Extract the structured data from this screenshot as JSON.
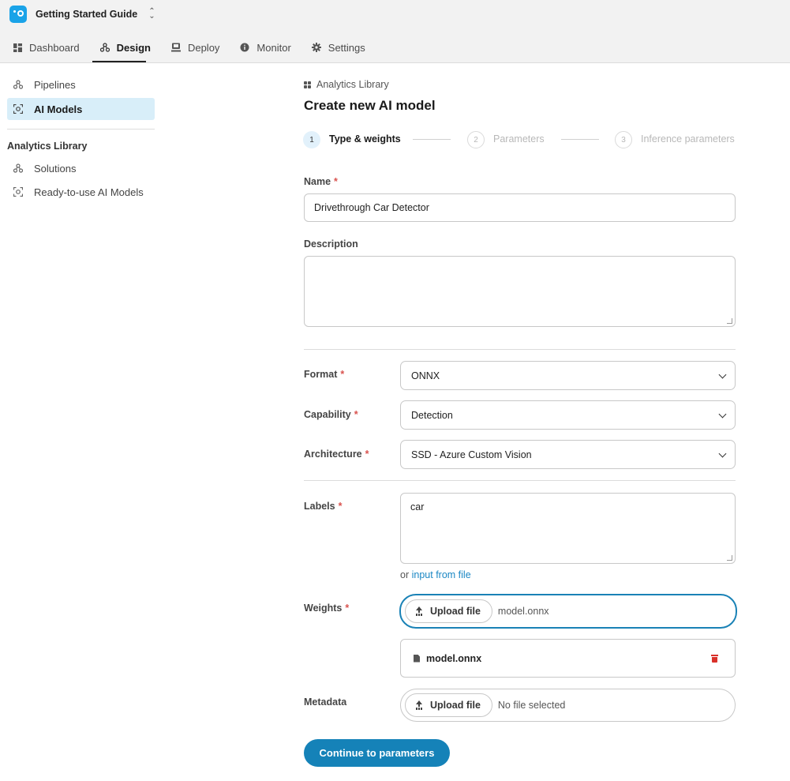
{
  "header": {
    "project_name": "Getting Started Guide",
    "switcher_icon": "chevron-up-down-icon",
    "tabs": [
      {
        "label": "Dashboard",
        "icon": "dashboard-icon"
      },
      {
        "label": "Design",
        "icon": "design-icon",
        "active": true
      },
      {
        "label": "Deploy",
        "icon": "deploy-icon"
      },
      {
        "label": "Monitor",
        "icon": "info-icon"
      },
      {
        "label": "Settings",
        "icon": "gear-icon"
      }
    ]
  },
  "sidebar": {
    "items": [
      {
        "label": "Pipelines",
        "icon": "pipelines-icon"
      },
      {
        "label": "AI Models",
        "icon": "ai-model-icon",
        "active": true
      }
    ],
    "section_title": "Analytics Library",
    "section_items": [
      {
        "label": "Solutions",
        "icon": "pipelines-icon"
      },
      {
        "label": "Ready-to-use AI Models",
        "icon": "ai-model-icon"
      }
    ]
  },
  "main": {
    "breadcrumb": "Analytics Library",
    "title": "Create new AI model",
    "steps": [
      {
        "number": "1",
        "label": "Type & weights",
        "active": true
      },
      {
        "number": "2",
        "label": "Parameters"
      },
      {
        "number": "3",
        "label": "Inference parameters"
      }
    ],
    "form": {
      "name_label": "Name",
      "name_value": "Drivethrough Car Detector",
      "description_label": "Description",
      "description_value": "",
      "format_label": "Format",
      "format_value": "ONNX",
      "capability_label": "Capability",
      "capability_value": "Detection",
      "architecture_label": "Architecture",
      "architecture_value": "SSD - Azure Custom Vision",
      "labels_label": "Labels",
      "labels_value": "car",
      "labels_or": "or",
      "labels_link": "input from file",
      "weights_label": "Weights",
      "weights_button": "Upload file",
      "weights_file": "model.onnx",
      "weights_uploaded_name": "model.onnx",
      "metadata_label": "Metadata",
      "metadata_button": "Upload file",
      "metadata_file": "No file selected",
      "required_marker": "*"
    },
    "continue_button": "Continue to parameters"
  },
  "colors": {
    "accent": "#1582b8",
    "active_bg": "#d8eef9",
    "required": "#d9534f",
    "delete": "#d9312a"
  }
}
